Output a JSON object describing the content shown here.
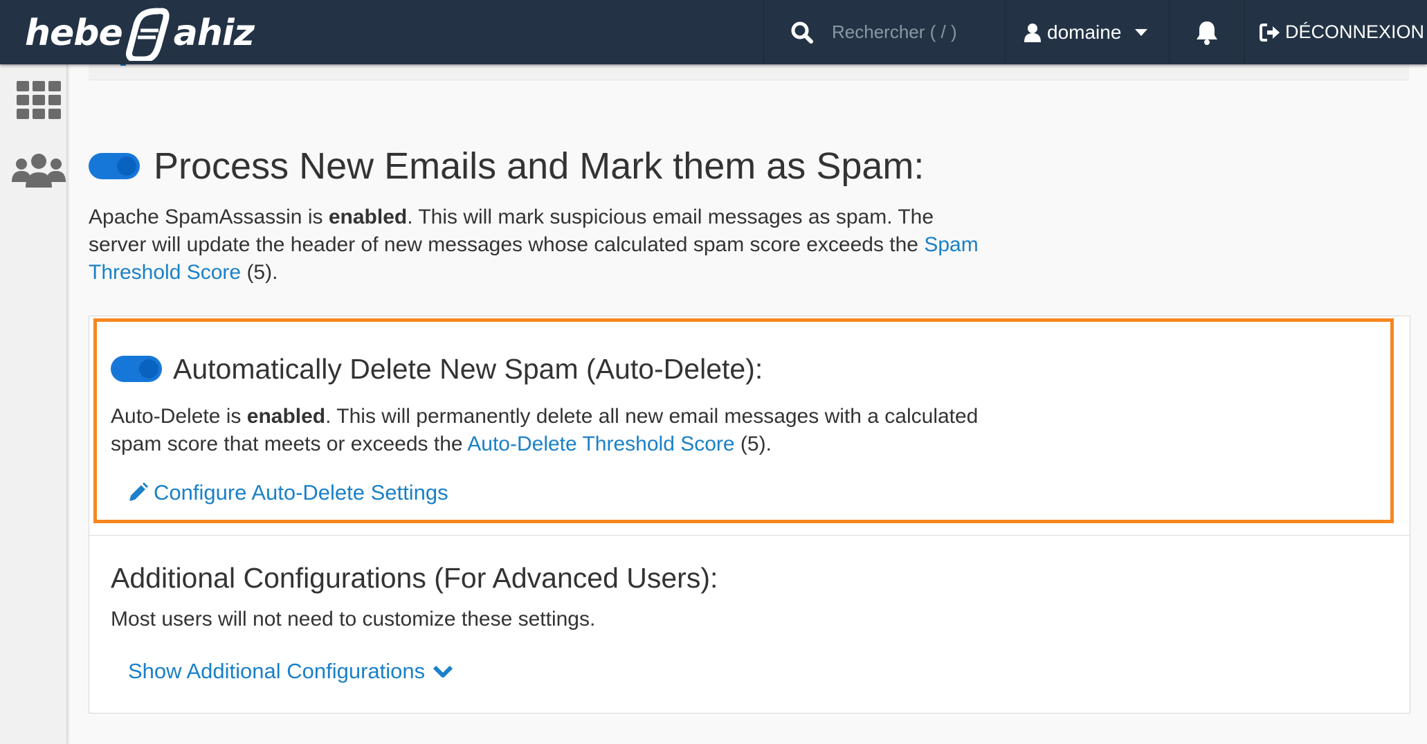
{
  "header": {
    "logo_text_left": "hebe",
    "logo_text_right": "ahiz",
    "search_placeholder": "Rechercher ( / )",
    "user_name": "domaine",
    "logout_label": "DÉCONNEXION"
  },
  "sidebar": {
    "items": [
      {
        "icon": "grid-icon"
      },
      {
        "icon": "users-icon"
      }
    ]
  },
  "main": {
    "spam_section": {
      "title": "Process New Emails and Mark them as Spam:",
      "toggle_enabled": true,
      "desc_prefix": "Apache SpamAssassin is ",
      "desc_bold": "enabled",
      "desc_mid": ". This will mark suspicious email messages as spam. The server will update the header of new messages whose calculated spam score exceeds the ",
      "desc_link": "Spam Threshold Score",
      "desc_suffix": " (5)."
    },
    "autodelete_section": {
      "title": "Automatically Delete New Spam (Auto-Delete):",
      "toggle_enabled": true,
      "desc_prefix": "Auto-Delete is ",
      "desc_bold": "enabled",
      "desc_mid": ". This will permanently delete all new email messages with a calculated spam score that meets or exceeds the ",
      "desc_link": "Auto-Delete Threshold Score",
      "desc_suffix": " (5).",
      "configure_link": "Configure Auto-Delete Settings"
    },
    "additional_section": {
      "title": "Additional Configurations (For Advanced Users):",
      "desc": "Most users will not need to customize these settings.",
      "show_link": "Show Additional Configurations"
    }
  },
  "colors": {
    "topbar": "#233345",
    "link": "#1a80c8",
    "toggle": "#1777d9",
    "highlight": "#f6871f"
  }
}
